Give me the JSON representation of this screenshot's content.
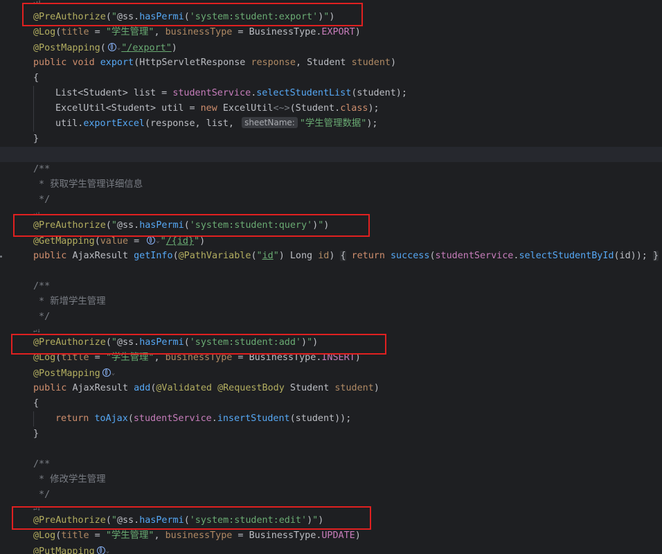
{
  "editor": {
    "lines": {
      "l1": {
        "marker": "↵↓"
      },
      "l2": {
        "annot": "@PreAuthorize",
        "open": "(",
        "q1": "\"",
        "ss": "@ss.",
        "method": "hasPermi",
        "p1": "(",
        "perm": "'system:student:export'",
        "p2": ")",
        "q2": "\"",
        "close": ")"
      },
      "l3": {
        "annot": "@Log",
        "p1": "(",
        "k1": "title",
        "eq1": " = ",
        "v1": "\"学生管理\"",
        "comma": ", ",
        "k2": "businessType",
        "eq2": " = ",
        "cls": "BusinessType",
        "dot": ".",
        "const": "EXPORT",
        "p2": ")"
      },
      "l4": {
        "annot": "@PostMapping",
        "p1": "(",
        "chev": "⌄",
        "path": "\"/export\"",
        "p2": ")"
      },
      "l5": {
        "kw1": "public",
        "kw2": "void",
        "name": "export",
        "p1": "(",
        "type1": "HttpServletResponse",
        "param1": "response",
        "comma": ", ",
        "type2": "Student",
        "param2": "student",
        "p2": ")"
      },
      "l6": {
        "text": "{"
      },
      "l7": {
        "type": "List",
        "gen": "<Student>",
        "var": " list = ",
        "svc": "studentService",
        "dot": ".",
        "call": "selectStudentList",
        "args": "(student);"
      },
      "l8": {
        "type": "ExcelUtil",
        "gen": "<Student>",
        "var": " util = ",
        "kw": "new",
        "ctor": "ExcelUtil",
        "diamond": "<~>",
        "args1": "(Student.",
        "classkw": "class",
        "args2": ");"
      },
      "l9": {
        "obj": "util.",
        "call": "exportExcel",
        "args": "(response, list, ",
        "hint": "sheetName:",
        "str": "\"学生管理数据\"",
        "end": ");"
      },
      "l10": {
        "text": "}"
      },
      "l12": {
        "text": "/**"
      },
      "l13": {
        "text": " * 获取学生管理详细信息"
      },
      "l14": {
        "text": " */"
      },
      "l15": {
        "marker": "↵↓"
      },
      "l16": {
        "annot": "@PreAuthorize",
        "open": "(",
        "q1": "\"",
        "ss": "@ss.",
        "method": "hasPermi",
        "p1": "(",
        "perm": "'system:student:query'",
        "p2": ")",
        "q2": "\"",
        "close": ")"
      },
      "l17": {
        "annot": "@GetMapping",
        "p1": "(",
        "k": "value",
        "eq": " = ",
        "chev": "⌄",
        "q1": "\"",
        "path": "/{id}",
        "q2": "\"",
        "p2": ")"
      },
      "l18": {
        "kw1": "public",
        "type": "AjaxResult",
        "name": "getInfo",
        "p1": "(",
        "ann": "@PathVariable",
        "a1": "(",
        "q1": "\"",
        "id": "id",
        "q2": "\"",
        "a2": ")",
        "type2": " Long ",
        "param": "id",
        "p2": ")",
        "b1": "{",
        "ret": "return",
        "fn": "success",
        "a3": "(",
        "svc": "studentService",
        "dot": ".",
        "call": "selectStudentById",
        "args": "(id));",
        "b2": "}"
      },
      "l20": {
        "text": "/**"
      },
      "l21": {
        "text": " * 新增学生管理"
      },
      "l22": {
        "text": " */"
      },
      "l23": {
        "marker": "↵↓"
      },
      "l24": {
        "annot": "@PreAuthorize",
        "open": "(",
        "q1": "\"",
        "ss": "@ss.",
        "method": "hasPermi",
        "p1": "(",
        "perm": "'system:student:add'",
        "p2": ")",
        "q2": "\"",
        "close": ")"
      },
      "l25": {
        "annot": "@Log",
        "p1": "(",
        "k1": "title",
        "eq1": " = ",
        "v1": "\"学生管理\"",
        "comma": ", ",
        "k2": "businessType",
        "eq2": " = ",
        "cls": "BusinessType",
        "dot": ".",
        "const": "INSERT",
        "p2": ")"
      },
      "l26": {
        "annot": "@PostMapping",
        "chev": "⌄"
      },
      "l27": {
        "kw1": "public",
        "type": "AjaxResult",
        "name": "add",
        "p1": "(",
        "ann1": "@Validated",
        "ann2": "@RequestBody",
        "type2": "Student",
        "param": "student",
        "p2": ")"
      },
      "l28": {
        "text": "{"
      },
      "l29": {
        "kw": "return",
        "call": "toAjax",
        "p1": "(",
        "svc": "studentService",
        "dot": ".",
        "call2": "insertStudent",
        "args": "(student));"
      },
      "l30": {
        "text": "}"
      },
      "l32": {
        "text": "/**"
      },
      "l33": {
        "text": " * 修改学生管理"
      },
      "l34": {
        "text": " */"
      },
      "l35": {
        "marker": "↵↓"
      },
      "l36": {
        "annot": "@PreAuthorize",
        "open": "(",
        "q1": "\"",
        "ss": "@ss.",
        "method": "hasPermi",
        "p1": "(",
        "perm": "'system:student:edit'",
        "p2": ")",
        "q2": "\"",
        "close": ")"
      },
      "l37": {
        "annot": "@Log",
        "p1": "(",
        "k1": "title",
        "eq1": " = ",
        "v1": "\"学生管理\"",
        "comma": ", ",
        "k2": "businessType",
        "eq2": " = ",
        "cls": "BusinessType",
        "dot": ".",
        "const": "UPDATE",
        "p2": ")"
      },
      "l38": {
        "annot": "@PutMapping",
        "chev": "⌄"
      }
    }
  },
  "colors": {
    "highlight_box": "#e02020",
    "background": "#1e1f22",
    "annotation": "#b3ae60",
    "string": "#6aab73",
    "keyword": "#cf8e6d",
    "function": "#56a8f5",
    "field": "#c77dbb",
    "comment": "#7a7e85"
  },
  "icons": {
    "url_icon": "globe-icon",
    "chevron": "chevron-down-icon"
  }
}
